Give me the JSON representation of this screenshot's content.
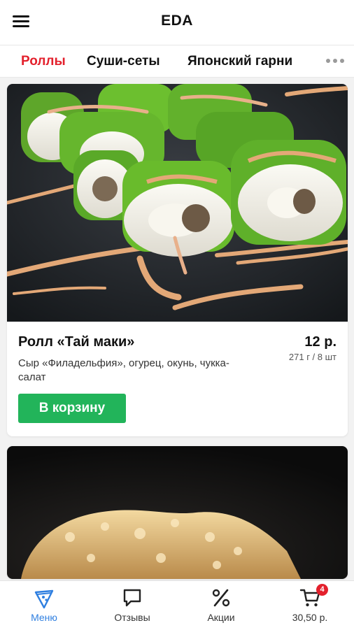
{
  "header": {
    "title": "EDA"
  },
  "tabs": [
    {
      "label": "Роллы",
      "active": true
    },
    {
      "label": "Суши-сеты"
    },
    {
      "label": "Японский гарни"
    }
  ],
  "products": [
    {
      "name": "Ролл «Тай маки»",
      "price": "12 р.",
      "weight": "271 г / 8 шт",
      "description": "Сыр «Филадельфия», огурец, окунь, чукка-салат",
      "button": "В корзину"
    }
  ],
  "bottom_nav": {
    "items": [
      {
        "label": "Меню",
        "icon": "pizza-slice-icon",
        "active": true
      },
      {
        "label": "Отзывы",
        "icon": "chat-bubble-icon"
      },
      {
        "label": "Акции",
        "icon": "percent-icon"
      },
      {
        "label": "30,50 р.",
        "icon": "cart-icon"
      }
    ],
    "cart_badge": "4"
  },
  "colors": {
    "accent": "#e3202c",
    "button": "#22b45a",
    "nav_active": "#2f7fe0"
  }
}
